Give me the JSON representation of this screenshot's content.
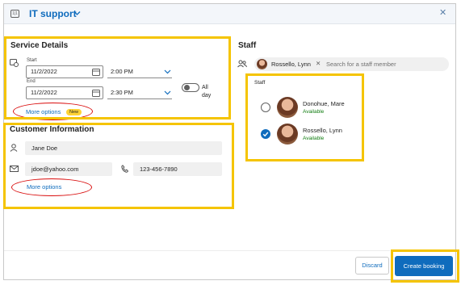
{
  "header": {
    "title": "IT support",
    "cal_icon_text": "1|1"
  },
  "service": {
    "title": "Service Details",
    "start_label": "Start",
    "start_date": "11/2/2022",
    "start_time": "2:00 PM",
    "end_label": "End",
    "end_date": "11/2/2022",
    "end_time": "2:30 PM",
    "all_day_label_1": "All",
    "all_day_label_2": "day",
    "all_day_on": false,
    "more_options": "More options",
    "new_badge": "New"
  },
  "customer": {
    "title": "Customer Information",
    "name": "Jane Doe",
    "email": "jdoe@yahoo.com",
    "phone": "123-456-7890",
    "more_options": "More options"
  },
  "staff": {
    "title": "Staff",
    "selected_chip": "Rossello, Lynn",
    "search_placeholder": "Search for a staff member",
    "list_label": "Staff",
    "members": [
      {
        "name": "Donohue, Mare",
        "status": "Available",
        "selected": false
      },
      {
        "name": "Rossello, Lynn",
        "status": "Available",
        "selected": true
      }
    ]
  },
  "footer": {
    "discard": "Discard",
    "create": "Create booking"
  },
  "colors": {
    "accent": "#0f6cbd",
    "highlight": "#f5c400",
    "annotation": "#d90c0c",
    "available": "#107c10"
  },
  "icons": [
    "calendar-icon",
    "chevron-down-icon",
    "close-icon",
    "clock-calendar-icon",
    "date-picker-icon",
    "person-icon",
    "mail-icon",
    "phone-icon",
    "people-icon",
    "checkmark-icon"
  ]
}
